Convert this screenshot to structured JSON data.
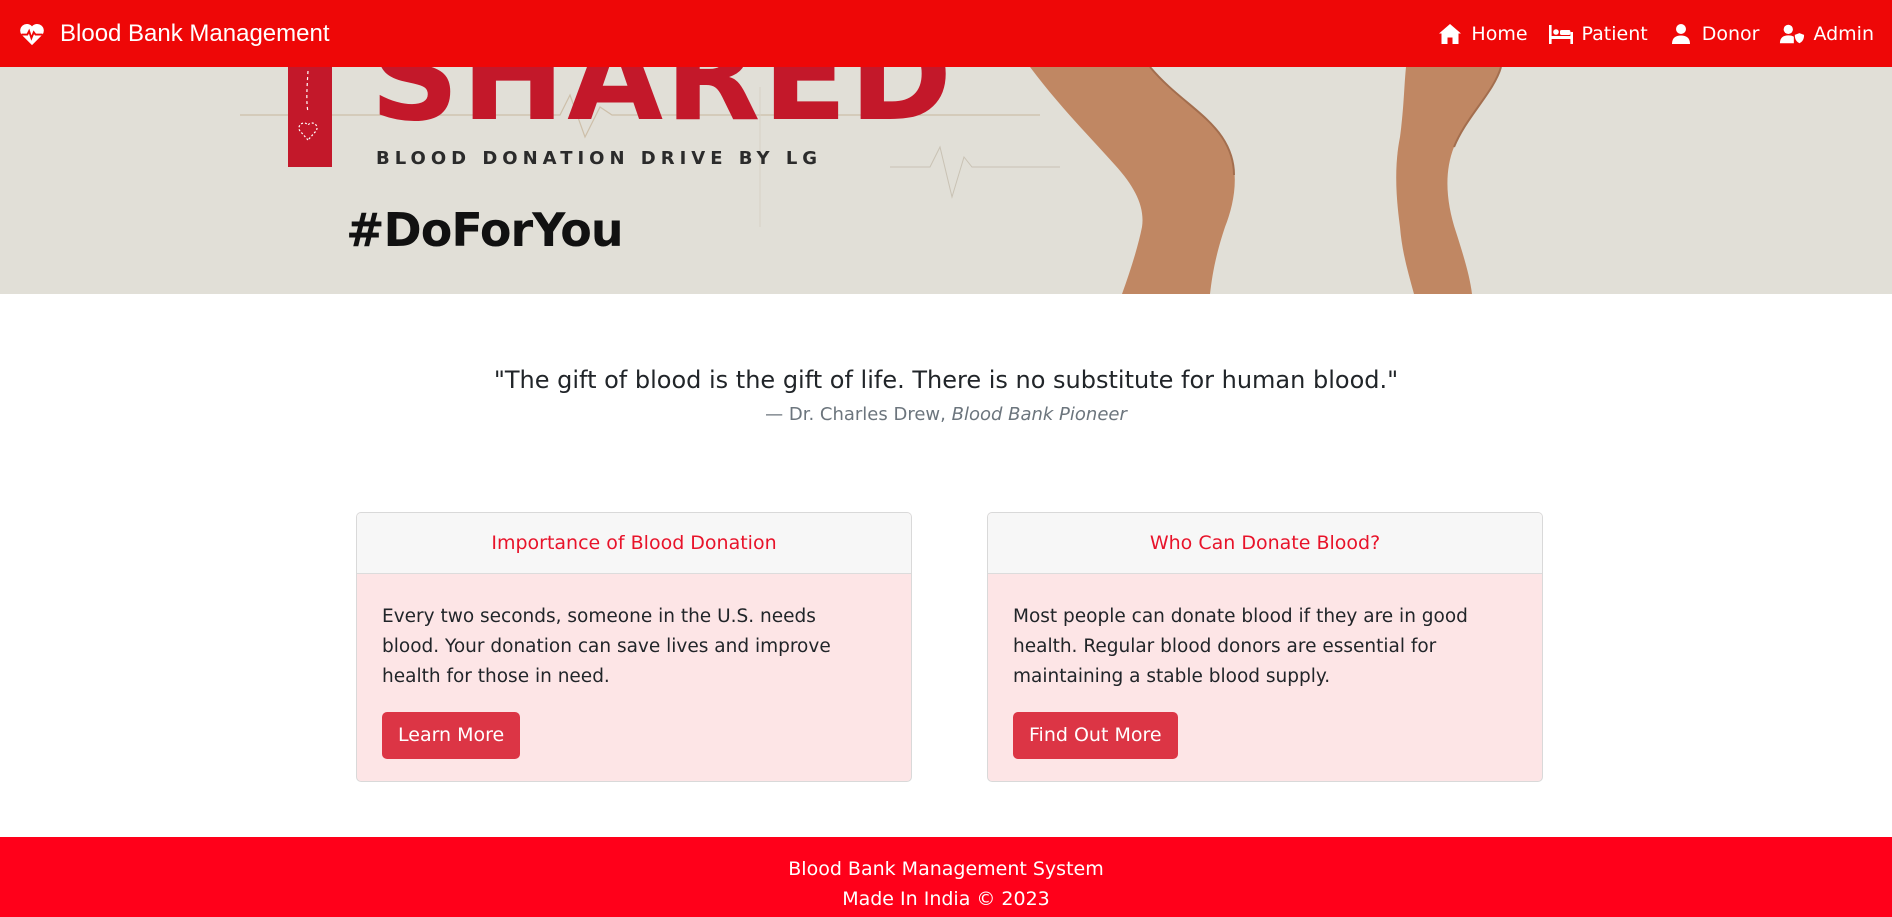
{
  "navbar": {
    "brand": "Blood Bank Management",
    "brand_icon": "heart-pulse-icon",
    "links": [
      {
        "label": "Home",
        "icon": "home-icon"
      },
      {
        "label": "Patient",
        "icon": "bed-icon"
      },
      {
        "label": "Donor",
        "icon": "user-icon"
      },
      {
        "label": "Admin",
        "icon": "user-shield-icon"
      }
    ],
    "bg_color": "#ee0707"
  },
  "hero": {
    "headline": "SHARED",
    "subline": "BLOOD DONATION DRIVE BY LG",
    "hashtag": "#DoForYou",
    "bg_color": "#e1dfd7",
    "accent": "#c3182a"
  },
  "quote": {
    "text": "\"The gift of blood is the gift of life. There is no substitute for human blood.\"",
    "author_name": "— Dr. Charles Drew, ",
    "author_title": "Blood Bank Pioneer"
  },
  "cards": [
    {
      "title": "Importance of Blood Donation",
      "body": "Every two seconds, someone in the U.S. needs blood. Your donation can save lives and improve health for those in need.",
      "button": "Learn More"
    },
    {
      "title": "Who Can Donate Blood?",
      "body": "Most people can donate blood if they are in good health. Regular blood donors are essential for maintaining a stable blood supply.",
      "button": "Find Out More"
    }
  ],
  "footer": {
    "line1": "Blood Bank Management System",
    "line2": "Made In India © 2023",
    "bg_color": "#ff001a"
  }
}
